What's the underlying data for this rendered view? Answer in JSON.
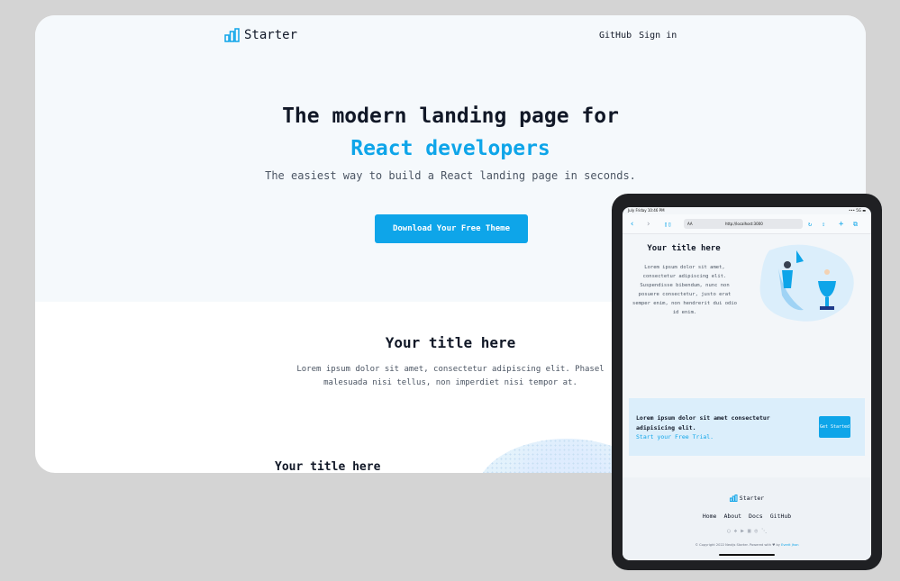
{
  "desktop": {
    "logo_text": "Starter",
    "nav": [
      "GitHub",
      "Sign in"
    ],
    "hero": {
      "title_line1": "The modern landing page for",
      "title_line2": "React developers",
      "subtitle": "The easiest way to build a React landing page in seconds.",
      "cta_label": "Download Your Free Theme"
    },
    "section": {
      "title": "Your title here",
      "text_line1": "Lorem ipsum dolor sit amet, consectetur adipiscing elit. Phasel",
      "text_line2": "malesuada nisi tellus, non imperdiet nisi tempor at."
    },
    "section2": {
      "title": "Your title here"
    }
  },
  "ipad": {
    "status_left": "July Friday 10:46 PM",
    "status_right": "••• 5G ▬",
    "url_aa": "AA",
    "url": "http://localhost:3000",
    "hero": {
      "title": "Your title here",
      "text": "Lorem ipsum dolor sit amet, consectetur adipiscing elit. Suspendisse bibendum, nunc non posuere consectetur, justo erat semper enim, non hendrerit dui odio id enim."
    },
    "cta": {
      "text": "Lorem ipsum dolor sit amet consectetur adipisicing elit.",
      "link": "Start your Free Trial.",
      "button": "Get Started"
    },
    "footer": {
      "logo_text": "Starter",
      "nav": [
        "Home",
        "About",
        "Docs",
        "GitHub"
      ],
      "social_icons": [
        "github-icon",
        "twitter-icon",
        "youtube-icon",
        "linkedin-icon",
        "instagram-icon",
        "rss-icon"
      ],
      "copyright_prefix": "© Copyright 2022 Nextjs Starter. Powered with ♥ by",
      "copyright_link": "Everit Jhon"
    }
  },
  "colors": {
    "accent": "#0ea5e9",
    "background": "#d4d4d4",
    "hero_bg": "#f5f9fc"
  }
}
